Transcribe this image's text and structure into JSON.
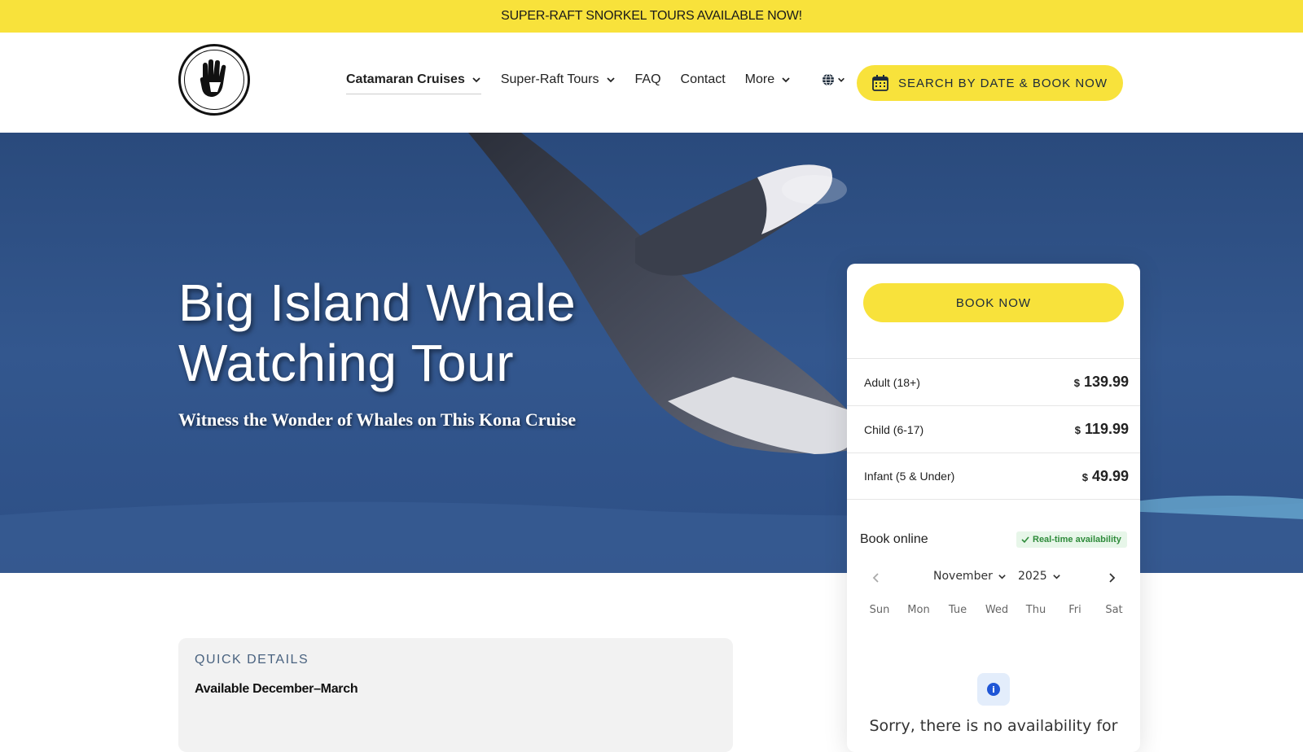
{
  "announcement": "SUPER-RAFT SNORKEL TOURS AVAILABLE NOW!",
  "logo": {
    "name": "Body Glove"
  },
  "nav": {
    "items": [
      {
        "label": "Catamaran Cruises",
        "has_dropdown": true,
        "active": true
      },
      {
        "label": "Super-Raft Tours",
        "has_dropdown": true,
        "active": false
      },
      {
        "label": "FAQ",
        "has_dropdown": false,
        "active": false
      },
      {
        "label": "Contact",
        "has_dropdown": false,
        "active": false
      },
      {
        "label": "More",
        "has_dropdown": true,
        "active": false
      }
    ],
    "language_icon": "globe-icon",
    "search_button": "SEARCH BY DATE & BOOK NOW",
    "search_icon": "calendar-icon"
  },
  "hero": {
    "title": "Big Island Whale Watching Tour",
    "subtitle": "Witness the Wonder of Whales on This Kona Cruise"
  },
  "quick_details": {
    "label": "QUICK DETAILS",
    "value": "Available December–March"
  },
  "booking": {
    "book_now": "BOOK NOW",
    "currency": "$",
    "prices": [
      {
        "label": "Adult (18+)",
        "price": "139.99"
      },
      {
        "label": "Child (6-17)",
        "price": "119.99"
      },
      {
        "label": "Infant (5 & Under)",
        "price": "49.99"
      }
    ],
    "book_online": "Book online",
    "realtime_badge": "Real-time availability",
    "calendar": {
      "month": "November",
      "year": "2025",
      "weekdays": [
        "Sun",
        "Mon",
        "Tue",
        "Wed",
        "Thu",
        "Fri",
        "Sat"
      ]
    },
    "no_availability": "Sorry, there is no availability for"
  },
  "colors": {
    "accent_yellow": "#f8e23b",
    "badge_green": "#2e8b3a",
    "info_blue": "#1f56d6"
  }
}
